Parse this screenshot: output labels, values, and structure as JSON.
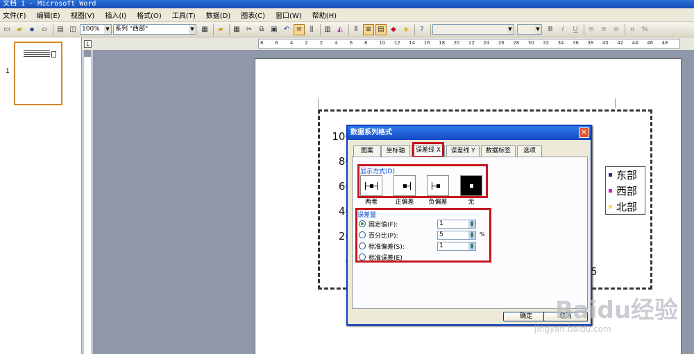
{
  "window": {
    "title": "文档 1 - Microsoft Word"
  },
  "menu": [
    "文件(F)",
    "编辑(E)",
    "视图(V)",
    "插入(I)",
    "格式(O)",
    "工具(T)",
    "数据(D)",
    "图表(C)",
    "窗口(W)",
    "帮助(H)"
  ],
  "toolbar": {
    "zoom": "100%",
    "series_select": "系列 \"西部\""
  },
  "thumbs": {
    "page_number": "1"
  },
  "ruler": {
    "ticks": [
      "8",
      "6",
      "4",
      "2",
      "2",
      "4",
      "6",
      "8",
      "10",
      "12",
      "14",
      "16",
      "18",
      "20",
      "22",
      "24",
      "26",
      "28",
      "30",
      "32",
      "34",
      "36",
      "38",
      "40",
      "42",
      "44",
      "46",
      "48"
    ]
  },
  "chart": {
    "y_ticks": [
      "100",
      "80",
      "60",
      "40",
      "20",
      "0"
    ],
    "x_tail": "5",
    "legend": [
      {
        "label": "东部",
        "color": "#1e2e8e"
      },
      {
        "label": "西部",
        "color": "#d21ac8"
      },
      {
        "label": "北部",
        "color": "#f2e14a"
      }
    ]
  },
  "dialog": {
    "title": "数据系列格式",
    "tabs": [
      "图案",
      "坐标轴",
      "误差线 X",
      "误差线 Y",
      "数据标签",
      "选项"
    ],
    "selected_tab": "误差线 X",
    "display_group": "显示方式(D)",
    "display_options": [
      "两者",
      "正偏差",
      "负偏差",
      "无"
    ],
    "amount_group": "误差量",
    "amount_options": [
      {
        "label": "固定值(F):",
        "value": "1",
        "selected": true
      },
      {
        "label": "百分比(P):",
        "value": "5",
        "unit": "%",
        "selected": false
      },
      {
        "label": "标准偏差(S):",
        "value": "1",
        "selected": false
      },
      {
        "label": "标准误差(E)",
        "selected": false
      }
    ],
    "ok": "确定",
    "cancel": "取消"
  },
  "watermark": {
    "brand": "Baidu经验",
    "url": "jingyan.baidu.com"
  }
}
